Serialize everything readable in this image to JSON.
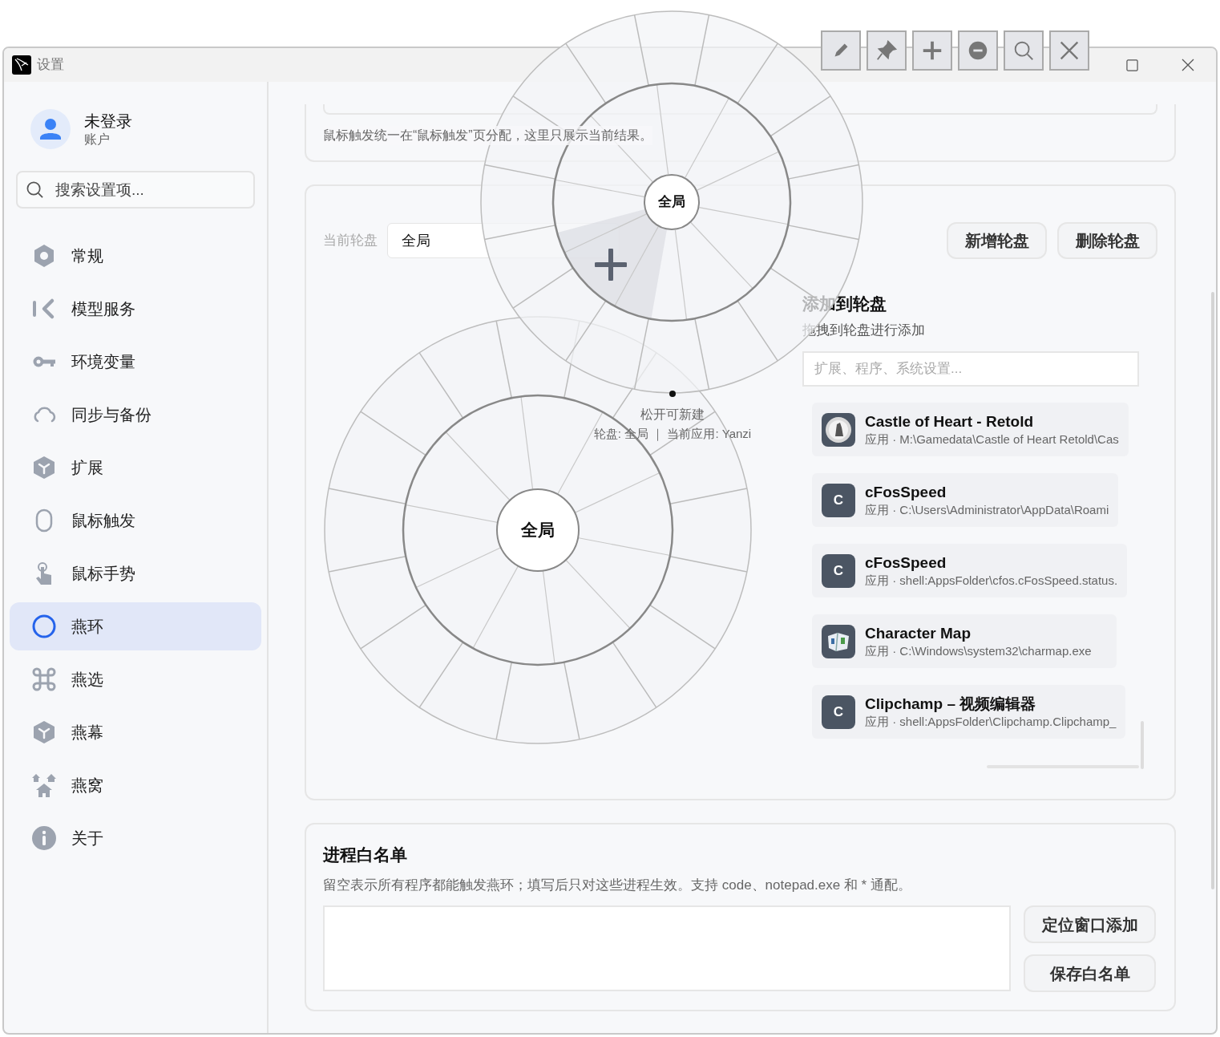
{
  "window": {
    "title": "设置"
  },
  "account": {
    "name": "未登录",
    "subtitle": "账户"
  },
  "sidebar_search": {
    "placeholder": "搜索设置项..."
  },
  "sidebar": {
    "items": [
      {
        "label": "常规",
        "kind": "nut",
        "selected": false
      },
      {
        "label": "模型服务",
        "kind": "bar-chevron",
        "selected": false
      },
      {
        "label": "环境变量",
        "kind": "key",
        "selected": false
      },
      {
        "label": "同步与备份",
        "kind": "cloud",
        "selected": false
      },
      {
        "label": "扩展",
        "kind": "cube",
        "selected": false
      },
      {
        "label": "鼠标触发",
        "kind": "mouse",
        "selected": false
      },
      {
        "label": "鼠标手势",
        "kind": "hand",
        "selected": false
      },
      {
        "label": "燕环",
        "kind": "ring",
        "selected": true
      },
      {
        "label": "燕选",
        "kind": "command",
        "selected": false
      },
      {
        "label": "燕幕",
        "kind": "cube",
        "selected": false
      },
      {
        "label": "燕窝",
        "kind": "houses",
        "selected": false
      },
      {
        "label": "关于",
        "kind": "info",
        "selected": false
      }
    ]
  },
  "trigger_card": {
    "note": "鼠标触发统一在“鼠标触发”页分配，这里只展示当前结果。"
  },
  "wheel_card": {
    "current_label": "当前轮盘",
    "current_value": "全局",
    "buttons": [
      "新增轮盘",
      "删除轮盘"
    ],
    "wheel_center": "全局",
    "add_panel": {
      "title": "添加到轮盘",
      "subtitle": "拖拽到轮盘进行添加",
      "search_placeholder": "扩展、程序、系统设置...",
      "items": [
        {
          "name": "Castle of Heart - Retold",
          "detail": "应用 · M:\\Gamedata\\Castle of Heart Retold\\Cas",
          "icon": {
            "kind": "game"
          }
        },
        {
          "name": "cFosSpeed",
          "detail": "应用 · C:\\Users\\Administrator\\AppData\\Roami",
          "icon": {
            "kind": "letter",
            "text": "C"
          }
        },
        {
          "name": "cFosSpeed",
          "detail": "应用 · shell:AppsFolder\\cfos.cFosSpeed.status.",
          "icon": {
            "kind": "letter",
            "text": "C"
          }
        },
        {
          "name": "Character Map",
          "detail": "应用 · C:\\Windows\\system32\\charmap.exe",
          "icon": {
            "kind": "charmap"
          }
        },
        {
          "name": "Clipchamp – 视频编辑器",
          "detail": "应用 · shell:AppsFolder\\Clipchamp.Clipchamp_",
          "icon": {
            "kind": "letter",
            "text": "C"
          }
        }
      ]
    }
  },
  "whitelist_card": {
    "title": "进程白名单",
    "description": "留空表示所有程序都能触发燕环；填写后只对这些进程生效。支持 code、notepad.exe 和 * 通配。",
    "buttons": [
      "定位窗口添加",
      "保存白名单"
    ]
  },
  "floating_wheel": {
    "center": "全局",
    "hint": "松开可新建",
    "status": "轮盘: 全局 ｜ 当前应用: Yanzi",
    "toolbar": [
      {
        "kind": "pencil"
      },
      {
        "kind": "pin"
      },
      {
        "kind": "plus"
      },
      {
        "kind": "minus"
      },
      {
        "kind": "search"
      },
      {
        "kind": "close"
      }
    ]
  }
}
